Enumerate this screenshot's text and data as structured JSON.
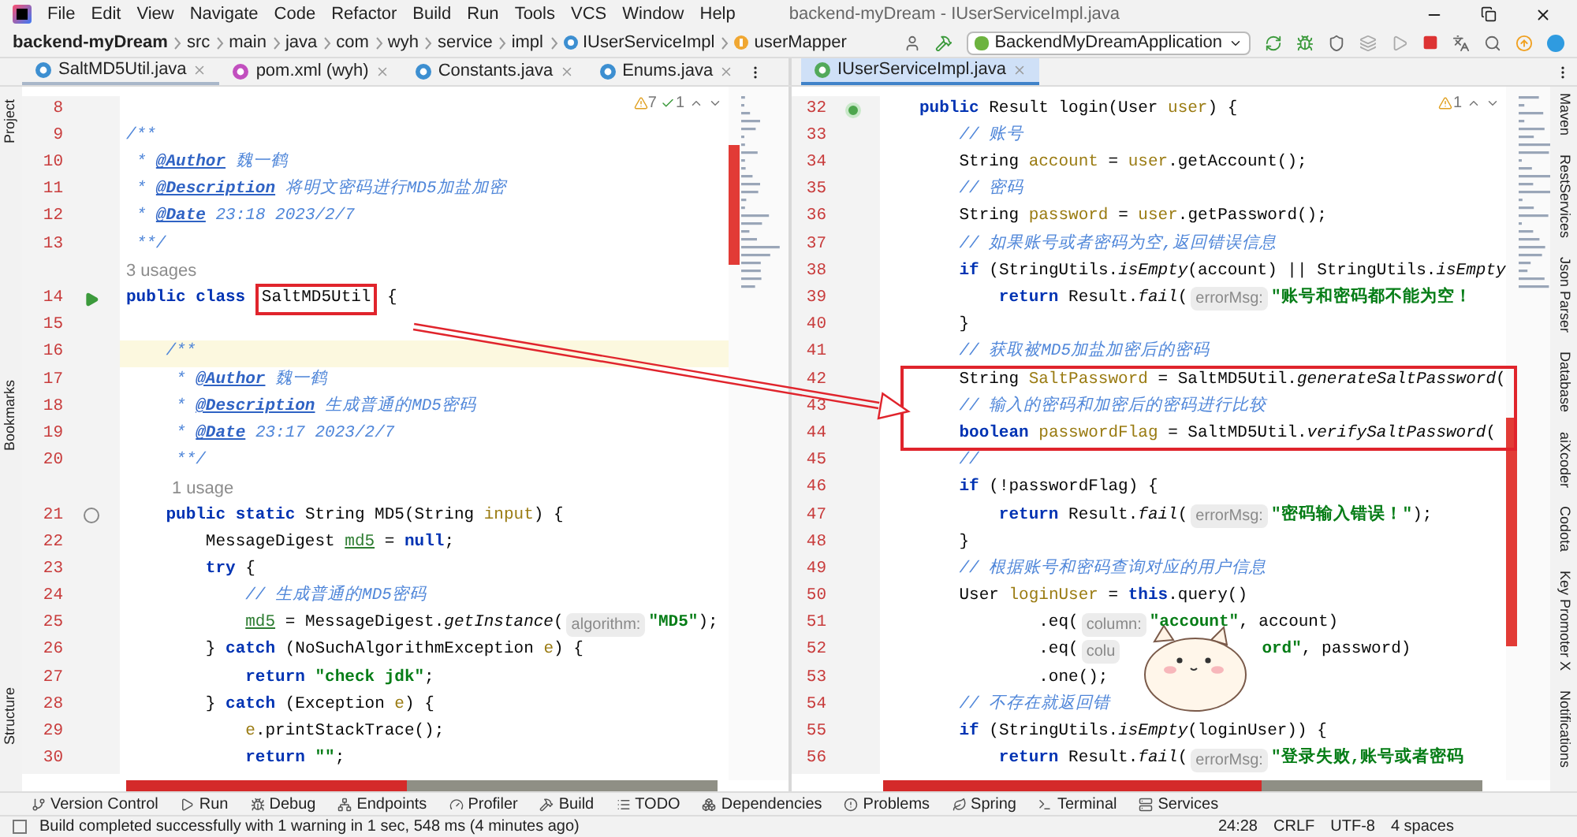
{
  "menu": [
    "File",
    "Edit",
    "View",
    "Navigate",
    "Code",
    "Refactor",
    "Build",
    "Run",
    "Tools",
    "VCS",
    "Window",
    "Help"
  ],
  "window_title": "backend-myDream - IUserServiceImpl.java",
  "breadcrumbs": [
    {
      "kind": "project",
      "text": "backend-myDream"
    },
    {
      "kind": "folder",
      "text": "src"
    },
    {
      "kind": "folder",
      "text": "main"
    },
    {
      "kind": "folder",
      "text": "java"
    },
    {
      "kind": "folder",
      "text": "com"
    },
    {
      "kind": "folder",
      "text": "wyh"
    },
    {
      "kind": "folder",
      "text": "service"
    },
    {
      "kind": "folder",
      "text": "impl"
    },
    {
      "kind": "class",
      "text": "IUserServiceImpl"
    },
    {
      "kind": "field",
      "text": "userMapper"
    }
  ],
  "run_config": "BackendMyDreamApplication",
  "left_tabs": [
    {
      "kind": "class",
      "label": "SaltMD5Util.java",
      "selected": true
    },
    {
      "kind": "maven",
      "label": "pom.xml (wyh)",
      "selected": false
    },
    {
      "kind": "class",
      "label": "Constants.java",
      "selected": false
    },
    {
      "kind": "enum",
      "label": "Enums.java",
      "selected": false
    }
  ],
  "right_tabs": [
    {
      "kind": "interface",
      "label": "IUserServiceImpl.java",
      "selected": true
    }
  ],
  "left_strip": [
    "Project",
    "Bookmarks",
    "Structure"
  ],
  "right_strip": [
    "Maven",
    "RestServices",
    "Json Parser",
    "Database",
    "aiXcoder",
    "Codota",
    "Key Promoter X",
    "Notifications"
  ],
  "left_editor": {
    "inspections": [
      {
        "kind": "warning",
        "text": "7"
      },
      {
        "kind": "ok",
        "text": "1"
      }
    ],
    "lines": [
      {
        "no": "8",
        "current": false
      },
      {
        "no": "9",
        "current": false,
        "tokens": [
          {
            "kind": "cmt",
            "text": "/**"
          }
        ]
      },
      {
        "no": "10",
        "current": false,
        "tokens": [
          {
            "kind": "cmt",
            "text": " * "
          },
          {
            "kind": "tag",
            "text": "@Author"
          },
          {
            "kind": "cmt",
            "text": " 魏一鹤"
          }
        ]
      },
      {
        "no": "11",
        "current": false,
        "tokens": [
          {
            "kind": "cmt",
            "text": " * "
          },
          {
            "kind": "tag",
            "text": "@Description"
          },
          {
            "kind": "cmt",
            "text": " 将明文密码进行MD5加盐加密"
          }
        ]
      },
      {
        "no": "12",
        "current": false,
        "tokens": [
          {
            "kind": "cmt",
            "text": " * "
          },
          {
            "kind": "tag",
            "text": "@Date"
          },
          {
            "kind": "cmt",
            "text": " 23:18 2023/2/7"
          }
        ]
      },
      {
        "no": "13",
        "current": false,
        "tokens": [
          {
            "kind": "cmt",
            "text": " **/"
          }
        ]
      },
      {
        "kind": "inlay",
        "indented": false,
        "text": "3 usages"
      },
      {
        "no": "14",
        "gutter": {
          "kind": "run"
        },
        "current": false,
        "tokens": [
          {
            "kind": "kw",
            "text": "public class "
          },
          {
            "kind": "boxed",
            "text": "SaltMD5Util"
          },
          {
            "kind": "txt",
            "text": " {"
          }
        ]
      },
      {
        "no": "15",
        "current": false
      },
      {
        "no": "16",
        "current": true,
        "tokens": [
          {
            "kind": "cmt",
            "text": "    /**"
          }
        ]
      },
      {
        "no": "17",
        "current": false,
        "tokens": [
          {
            "kind": "cmt",
            "text": "     * "
          },
          {
            "kind": "tag",
            "text": "@Author"
          },
          {
            "kind": "cmt",
            "text": " 魏一鹤"
          }
        ]
      },
      {
        "no": "18",
        "current": false,
        "tokens": [
          {
            "kind": "cmt",
            "text": "     * "
          },
          {
            "kind": "tag",
            "text": "@Description"
          },
          {
            "kind": "cmt",
            "text": " 生成普通的MD5密码"
          }
        ]
      },
      {
        "no": "19",
        "current": false,
        "tokens": [
          {
            "kind": "cmt",
            "text": "     * "
          },
          {
            "kind": "tag",
            "text": "@Date"
          },
          {
            "kind": "cmt",
            "text": " 23:17 2023/2/7"
          }
        ]
      },
      {
        "no": "20",
        "current": false,
        "tokens": [
          {
            "kind": "cmt",
            "text": "     **/"
          }
        ]
      },
      {
        "kind": "inlay",
        "indented": true,
        "text": "1 usage"
      },
      {
        "no": "21",
        "gutter": {
          "kind": "override"
        },
        "current": false,
        "tokens": [
          {
            "kind": "kw",
            "text": "    public static "
          },
          {
            "kind": "txt",
            "text": "String MD5(String "
          },
          {
            "kind": "var",
            "text": "input"
          },
          {
            "kind": "txt",
            "text": ") {"
          }
        ]
      },
      {
        "no": "22",
        "current": false,
        "tokens": [
          {
            "kind": "txt",
            "text": "        MessageDigest "
          },
          {
            "kind": "local",
            "text": "md5"
          },
          {
            "kind": "txt",
            "text": " = "
          },
          {
            "kind": "kw",
            "text": "null"
          },
          {
            "kind": "txt",
            "text": ";"
          }
        ]
      },
      {
        "no": "23",
        "current": false,
        "tokens": [
          {
            "kind": "kw",
            "text": "        try"
          },
          {
            "kind": "txt",
            "text": " {"
          }
        ]
      },
      {
        "no": "24",
        "current": false,
        "tokens": [
          {
            "kind": "cmt",
            "text": "            // 生成普通的MD5密码"
          }
        ]
      },
      {
        "no": "25",
        "current": false,
        "tokens": [
          {
            "kind": "local",
            "text": "            md5"
          },
          {
            "kind": "txt",
            "text": " = MessageDigest."
          },
          {
            "kind": "call",
            "text": "getInstance"
          },
          {
            "kind": "txt",
            "text": "("
          },
          {
            "kind": "hint",
            "text": "algorithm:"
          },
          {
            "kind": "str",
            "text": "\"MD5\""
          },
          {
            "kind": "txt",
            "text": ");"
          }
        ]
      },
      {
        "no": "26",
        "current": false,
        "tokens": [
          {
            "kind": "txt",
            "text": "        } "
          },
          {
            "kind": "kw",
            "text": "catch"
          },
          {
            "kind": "txt",
            "text": " (NoSuchAlgorithmException "
          },
          {
            "kind": "var",
            "text": "e"
          },
          {
            "kind": "txt",
            "text": ") {"
          }
        ]
      },
      {
        "no": "27",
        "current": false,
        "tokens": [
          {
            "kind": "kw",
            "text": "            return "
          },
          {
            "kind": "str",
            "text": "\"check jdk\""
          },
          {
            "kind": "txt",
            "text": ";"
          }
        ]
      },
      {
        "no": "28",
        "current": false,
        "tokens": [
          {
            "kind": "txt",
            "text": "        } "
          },
          {
            "kind": "kw",
            "text": "catch"
          },
          {
            "kind": "txt",
            "text": " (Exception "
          },
          {
            "kind": "var",
            "text": "e"
          },
          {
            "kind": "txt",
            "text": ") {"
          }
        ]
      },
      {
        "no": "29",
        "current": false,
        "tokens": [
          {
            "kind": "var",
            "text": "            e"
          },
          {
            "kind": "txt",
            "text": ".printStackTrace();"
          }
        ]
      },
      {
        "no": "30",
        "current": false,
        "tokens": [
          {
            "kind": "kw",
            "text": "            return "
          },
          {
            "kind": "str",
            "text": "\"\""
          },
          {
            "kind": "txt",
            "text": ";"
          }
        ]
      }
    ]
  },
  "right_editor": {
    "inspections": [
      {
        "kind": "warning",
        "text": "1"
      }
    ],
    "lines": [
      {
        "no": "32",
        "gutter": {
          "kind": "implements"
        },
        "current": false,
        "marked": false,
        "tokens": [
          {
            "kind": "kw",
            "text": "public "
          },
          {
            "kind": "txt",
            "text": "Result login(User "
          },
          {
            "kind": "var",
            "text": "user"
          },
          {
            "kind": "txt",
            "text": ") {"
          }
        ]
      },
      {
        "no": "33",
        "current": false,
        "marked": false,
        "tokens": [
          {
            "kind": "cmt",
            "text": "    // 账号"
          }
        ]
      },
      {
        "no": "34",
        "current": false,
        "marked": false,
        "tokens": [
          {
            "kind": "txt",
            "text": "    String "
          },
          {
            "kind": "var",
            "text": "account"
          },
          {
            "kind": "txt",
            "text": " = "
          },
          {
            "kind": "var",
            "text": "user"
          },
          {
            "kind": "txt",
            "text": ".getAccount();"
          }
        ]
      },
      {
        "no": "35",
        "current": false,
        "marked": false,
        "tokens": [
          {
            "kind": "cmt",
            "text": "    // 密码"
          }
        ]
      },
      {
        "no": "36",
        "current": false,
        "marked": false,
        "tokens": [
          {
            "kind": "txt",
            "text": "    String "
          },
          {
            "kind": "var",
            "text": "password"
          },
          {
            "kind": "txt",
            "text": " = "
          },
          {
            "kind": "var",
            "text": "user"
          },
          {
            "kind": "txt",
            "text": ".getPassword();"
          }
        ]
      },
      {
        "no": "37",
        "current": false,
        "marked": false,
        "tokens": [
          {
            "kind": "cmt",
            "text": "    // 如果账号或者密码为空,返回错误信息"
          }
        ]
      },
      {
        "no": "38",
        "current": false,
        "marked": false,
        "tokens": [
          {
            "kind": "kw",
            "text": "    if"
          },
          {
            "kind": "txt",
            "text": " (StringUtils."
          },
          {
            "kind": "call",
            "text": "isEmpty"
          },
          {
            "kind": "txt",
            "text": "(account) || StringUtils."
          },
          {
            "kind": "call",
            "text": "isEmpty"
          }
        ]
      },
      {
        "no": "39",
        "current": false,
        "marked": false,
        "tokens": [
          {
            "kind": "kw",
            "text": "        return "
          },
          {
            "kind": "txt",
            "text": "Result."
          },
          {
            "kind": "call",
            "text": "fail"
          },
          {
            "kind": "txt",
            "text": "("
          },
          {
            "kind": "hint",
            "text": "errorMsg:"
          },
          {
            "kind": "str",
            "text": "\"账号和密码都不能为空！"
          }
        ]
      },
      {
        "no": "40",
        "current": false,
        "marked": false,
        "tokens": [
          {
            "kind": "txt",
            "text": "    }"
          }
        ]
      },
      {
        "no": "41",
        "current": false,
        "marked": false,
        "tokens": [
          {
            "kind": "cmt",
            "text": "    // 获取被MD5加盐加密后的密码"
          }
        ]
      },
      {
        "no": "42",
        "current": false,
        "marked": true,
        "tokens": [
          {
            "kind": "txt",
            "text": "    String "
          },
          {
            "kind": "var",
            "text": "SaltPassword"
          },
          {
            "kind": "txt",
            "text": " = SaltMD5Util."
          },
          {
            "kind": "call",
            "text": "generateSaltPassword"
          },
          {
            "kind": "txt",
            "text": "("
          }
        ]
      },
      {
        "no": "43",
        "current": false,
        "marked": true,
        "tokens": [
          {
            "kind": "cmt",
            "text": "    // 输入的密码和加密后的密码进行比较"
          }
        ]
      },
      {
        "no": "44",
        "current": false,
        "marked": true,
        "tokens": [
          {
            "kind": "kw",
            "text": "    boolean "
          },
          {
            "kind": "var",
            "text": "passwordFlag"
          },
          {
            "kind": "txt",
            "text": " = SaltMD5Util."
          },
          {
            "kind": "call",
            "text": "verifySaltPassword"
          },
          {
            "kind": "txt",
            "text": "("
          }
        ]
      },
      {
        "no": "45",
        "current": false,
        "marked": false,
        "tokens": [
          {
            "kind": "cmt",
            "text": "    //"
          }
        ]
      },
      {
        "no": "46",
        "current": false,
        "marked": false,
        "tokens": [
          {
            "kind": "kw",
            "text": "    if"
          },
          {
            "kind": "txt",
            "text": " (!passwordFlag) {"
          }
        ]
      },
      {
        "no": "47",
        "current": false,
        "marked": false,
        "tokens": [
          {
            "kind": "kw",
            "text": "        return "
          },
          {
            "kind": "txt",
            "text": "Result."
          },
          {
            "kind": "call",
            "text": "fail"
          },
          {
            "kind": "txt",
            "text": "("
          },
          {
            "kind": "hint",
            "text": "errorMsg:"
          },
          {
            "kind": "str",
            "text": "\"密码输入错误！\""
          },
          {
            "kind": "txt",
            "text": ");"
          }
        ]
      },
      {
        "no": "48",
        "current": false,
        "marked": false,
        "tokens": [
          {
            "kind": "txt",
            "text": "    }"
          }
        ]
      },
      {
        "no": "49",
        "current": false,
        "marked": false,
        "tokens": [
          {
            "kind": "cmt",
            "text": "    // 根据账号和密码查询对应的用户信息"
          }
        ]
      },
      {
        "no": "50",
        "current": false,
        "marked": false,
        "tokens": [
          {
            "kind": "txt",
            "text": "    User "
          },
          {
            "kind": "var",
            "text": "loginUser"
          },
          {
            "kind": "txt",
            "text": " = "
          },
          {
            "kind": "kw",
            "text": "this"
          },
          {
            "kind": "txt",
            "text": ".query()"
          }
        ]
      },
      {
        "no": "51",
        "current": false,
        "marked": false,
        "tokens": [
          {
            "kind": "txt",
            "text": "            .eq("
          },
          {
            "kind": "hint",
            "text": "column:"
          },
          {
            "kind": "str",
            "text": "\"account\""
          },
          {
            "kind": "txt",
            "text": ", account)"
          }
        ]
      },
      {
        "no": "52",
        "current": false,
        "marked": false,
        "tokens": [
          {
            "kind": "txt",
            "text": "            .eq("
          },
          {
            "kind": "hint",
            "text": "colu"
          },
          {
            "kind": "gap"
          },
          {
            "kind": "str",
            "text": "ord\""
          },
          {
            "kind": "txt",
            "text": ", password)"
          }
        ]
      },
      {
        "no": "53",
        "current": false,
        "marked": false,
        "tokens": [
          {
            "kind": "txt",
            "text": "            .one();"
          }
        ]
      },
      {
        "no": "54",
        "current": false,
        "marked": false,
        "tokens": [
          {
            "kind": "cmt",
            "text": "    // 不存在就返回错"
          }
        ]
      },
      {
        "no": "55",
        "current": false,
        "marked": false,
        "tokens": [
          {
            "kind": "kw",
            "text": "    if"
          },
          {
            "kind": "txt",
            "text": " (StringUtils."
          },
          {
            "kind": "call",
            "text": "isEmpty"
          },
          {
            "kind": "txt",
            "text": "(loginUser)) {"
          }
        ]
      },
      {
        "no": "56",
        "current": false,
        "marked": false,
        "tokens": [
          {
            "kind": "kw",
            "text": "        return "
          },
          {
            "kind": "txt",
            "text": "Result."
          },
          {
            "kind": "call",
            "text": "fail"
          },
          {
            "kind": "txt",
            "text": "("
          },
          {
            "kind": "hint",
            "text": "errorMsg:"
          },
          {
            "kind": "str",
            "text": "\"登录失败,账号或者密码"
          }
        ]
      }
    ]
  },
  "bottom_tools": [
    {
      "kind": "branch",
      "label": "Version Control"
    },
    {
      "kind": "run",
      "label": "Run"
    },
    {
      "kind": "debug",
      "label": "Debug"
    },
    {
      "kind": "network",
      "label": "Endpoints"
    },
    {
      "kind": "gauge",
      "label": "Profiler"
    },
    {
      "kind": "build",
      "label": "Build"
    },
    {
      "kind": "list",
      "label": "TODO"
    },
    {
      "kind": "boxes",
      "label": "Dependencies"
    },
    {
      "kind": "alert",
      "label": "Problems"
    },
    {
      "kind": "leaf",
      "label": "Spring"
    },
    {
      "kind": "terminal",
      "label": "Terminal"
    },
    {
      "kind": "server",
      "label": "Services"
    }
  ],
  "status": {
    "message": "Build completed successfully with 1 warning in 1 sec, 548 ms (4 minutes ago)",
    "items": [
      "24:28",
      "CRLF",
      "UTF-8",
      "4 spaces"
    ]
  }
}
